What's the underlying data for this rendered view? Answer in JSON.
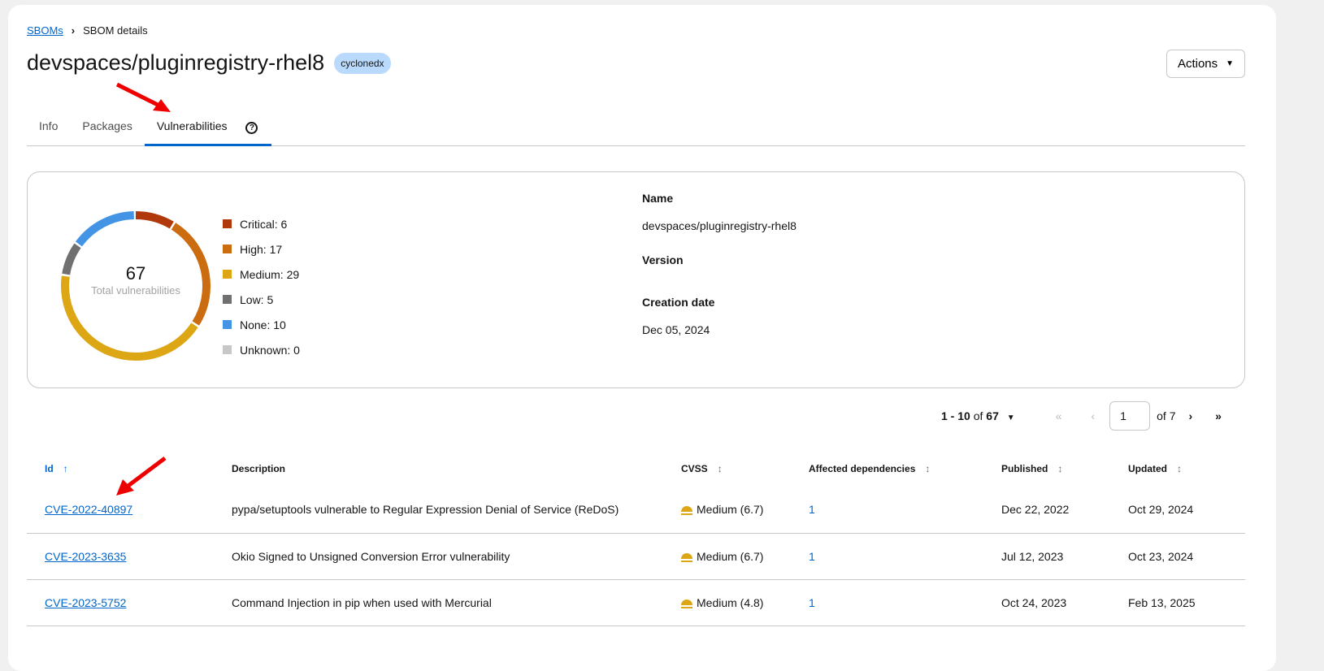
{
  "breadcrumb": {
    "root": "SBOMs",
    "current": "SBOM details"
  },
  "header": {
    "title": "devspaces/pluginregistry-rhel8",
    "badge": "cyclonedx",
    "actions_label": "Actions"
  },
  "tabs": [
    {
      "label": "Info"
    },
    {
      "label": "Packages"
    },
    {
      "label": "Vulnerabilities"
    }
  ],
  "summary": {
    "total": "67",
    "total_label": "Total vulnerabilities",
    "legend": [
      {
        "label": "Critical: 6",
        "value": 6,
        "color": "#b1380b"
      },
      {
        "label": "High: 17",
        "value": 17,
        "color": "#ca6c0f"
      },
      {
        "label": "Medium: 29",
        "value": 29,
        "color": "#dca614"
      },
      {
        "label": "Low: 5",
        "value": 5,
        "color": "#707070"
      },
      {
        "label": "None: 10",
        "value": 10,
        "color": "#4394e5"
      },
      {
        "label": "Unknown: 0",
        "value": 0,
        "color": "#c7c7c7"
      }
    ],
    "name_label": "Name",
    "name": "devspaces/pluginregistry-rhel8",
    "version_label": "Version",
    "date_label": "Creation date",
    "date": "Dec 05, 2024"
  },
  "pagination": {
    "range": "1 - 10",
    "of": "of",
    "total": "67",
    "page": "1",
    "pages_label": "of 7"
  },
  "table": {
    "headers": [
      "Id",
      "Description",
      "CVSS",
      "Affected dependencies",
      "Published",
      "Updated"
    ],
    "rows": [
      {
        "id": "CVE-2022-40897",
        "desc": "pypa/setuptools vulnerable to Regular Expression Denial of Service (ReDoS)",
        "cvss": "Medium (6.7)",
        "deps": "1",
        "published": "Dec 22, 2022",
        "updated": "Oct 29, 2024"
      },
      {
        "id": "CVE-2023-3635",
        "desc": "Okio Signed to Unsigned Conversion Error vulnerability",
        "cvss": "Medium (6.7)",
        "deps": "1",
        "published": "Jul 12, 2023",
        "updated": "Oct 23, 2024"
      },
      {
        "id": "CVE-2023-5752",
        "desc": "Command Injection in pip when used with Mercurial",
        "cvss": "Medium (4.8)",
        "deps": "1",
        "published": "Oct 24, 2023",
        "updated": "Feb 13, 2025"
      }
    ]
  }
}
